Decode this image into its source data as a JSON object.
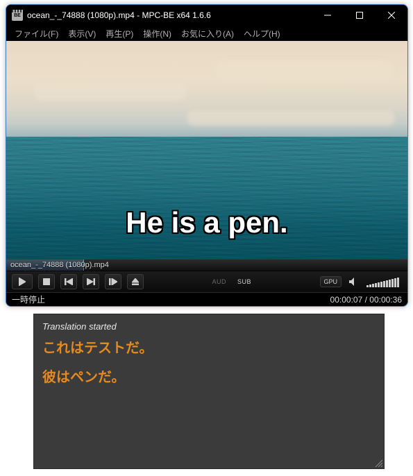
{
  "title_bar": {
    "app_icon_text": "BE",
    "title": "ocean_-_74888 (1080p).mp4 - MPC-BE x64 1.6.6"
  },
  "menu": {
    "file": "ファイル(F)",
    "view": "表示(V)",
    "play": "再生(P)",
    "nav": "操作(N)",
    "fav": "お気に入り(A)",
    "help": "ヘルプ(H)"
  },
  "video": {
    "subtitle": "He is a pen."
  },
  "seek": {
    "filename": "ocean_-_74888 (1080p).mp4"
  },
  "indicators": {
    "aud": "AUD",
    "sub": "SUB",
    "gpu": "GPU"
  },
  "status": {
    "state": "一時停止",
    "current": "00:00:07",
    "total": "00:00:36",
    "sep": " / "
  },
  "translation": {
    "header": "Translation started",
    "lines": [
      "これはテストだ。",
      "彼はペンだ。"
    ]
  }
}
